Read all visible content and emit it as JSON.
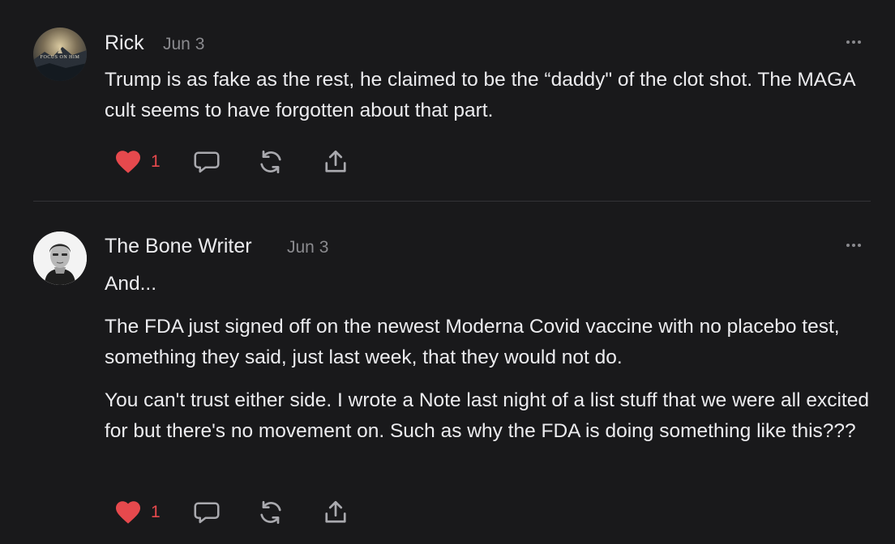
{
  "comments": [
    {
      "author": "Rick",
      "date": "Jun 3",
      "paragraphs": [
        "Trump is as fake as the rest, he claimed to be the “daddy\" of the clot shot. The MAGA cult seems to have forgotten about that part."
      ],
      "avatar_text": "FOCUS ON HIM",
      "likes": "1",
      "liked": true
    },
    {
      "author": "The Bone Writer",
      "date": "Jun 3",
      "paragraphs": [
        "And...",
        "The FDA just signed off on the newest Moderna Covid vaccine with no placebo test, something they said, just last week, that they would not do.",
        "You can't trust either side. I wrote a Note last night of a list stuff that we were all excited for but there's no movement on. Such as why the FDA is doing something like this???"
      ],
      "likes": "1",
      "liked": true
    }
  ],
  "icons": {
    "like": "heart-icon",
    "reply": "comment-bubble-icon",
    "restack": "restack-icon",
    "share": "share-icon",
    "more": "more-options-icon"
  },
  "colors": {
    "background": "#19191b",
    "text": "#ececef",
    "muted": "#8a8a8e",
    "liked": "#e6494d",
    "divider": "#333337"
  }
}
